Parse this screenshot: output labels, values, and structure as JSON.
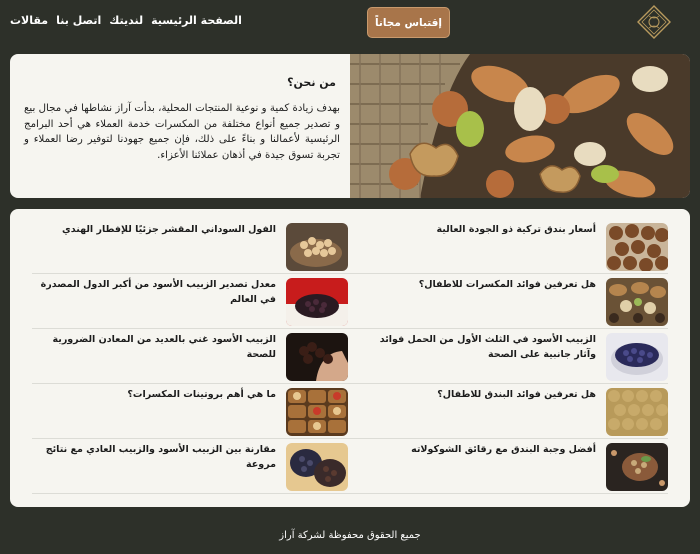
{
  "header": {
    "cta_label": "إقتباس مجاناً",
    "nav": [
      {
        "label": "الصفحة الرئيسية"
      },
      {
        "label": "لنديتك"
      },
      {
        "label": "اتصل بنا"
      },
      {
        "label": "مقالات"
      }
    ]
  },
  "about": {
    "title": "من نحن؟",
    "body": "بهدف زيادة كمية و نوعية المنتجات المحلية، بدأت آراز نشاطها في مجال بيع و تصدير جميع أنواع مختلفة من المكسرات خدمة العملاء هي أحد البرامج الرئيسية لأعمالنا و بناءً على ذلك، فإن جميع جهودنا لتوفير رضا العملاء و تجربة تسوق جيدة في أذهان عملائنا الأعزاء."
  },
  "articles": [
    {
      "title": "أسعار بندق تركية ذو الجودة العالية",
      "icon": "hazelnuts-image"
    },
    {
      "title": "الفول السوداني المقشر جزئيًا للإفطار الهندي",
      "icon": "peanuts-image"
    },
    {
      "title": "هل تعرفين فوائد المكسرات للاطفال؟",
      "icon": "mixed-nuts-image"
    },
    {
      "title": "معدل تصدير الزبيب الأسود من أكبر الدول المصدرة في العالم",
      "icon": "raisins-bowl-image"
    },
    {
      "title": "الزبيب الأسود في الثلث الأول من الحمل فوائد وآثار جانبية على الصحة",
      "icon": "black-raisins-image"
    },
    {
      "title": "الزبيب الأسود غني بالعديد من المعادن الضرورية للصحة",
      "icon": "raisins-hand-image"
    },
    {
      "title": "هل تعرفين فوائد البندق للاطفال؟",
      "icon": "hazelnut-pile-image"
    },
    {
      "title": "ما هي أهم بروتينات المكسرات؟",
      "icon": "nut-baskets-image"
    },
    {
      "title": "أفضل وجبة البندق مع رقائق الشوكولاته",
      "icon": "choco-hazelnut-image"
    },
    {
      "title": "مقارنة بين الزبيب الأسود والزبيب العادي مع نتائج مروعة",
      "icon": "raisin-bowls-image"
    }
  ],
  "footer": {
    "text": "جميع الحقوق محفوظة لشركة آراز"
  },
  "colors": {
    "dark": "#2d3029",
    "accent": "#a8754a",
    "panel": "#f6f5f0"
  }
}
